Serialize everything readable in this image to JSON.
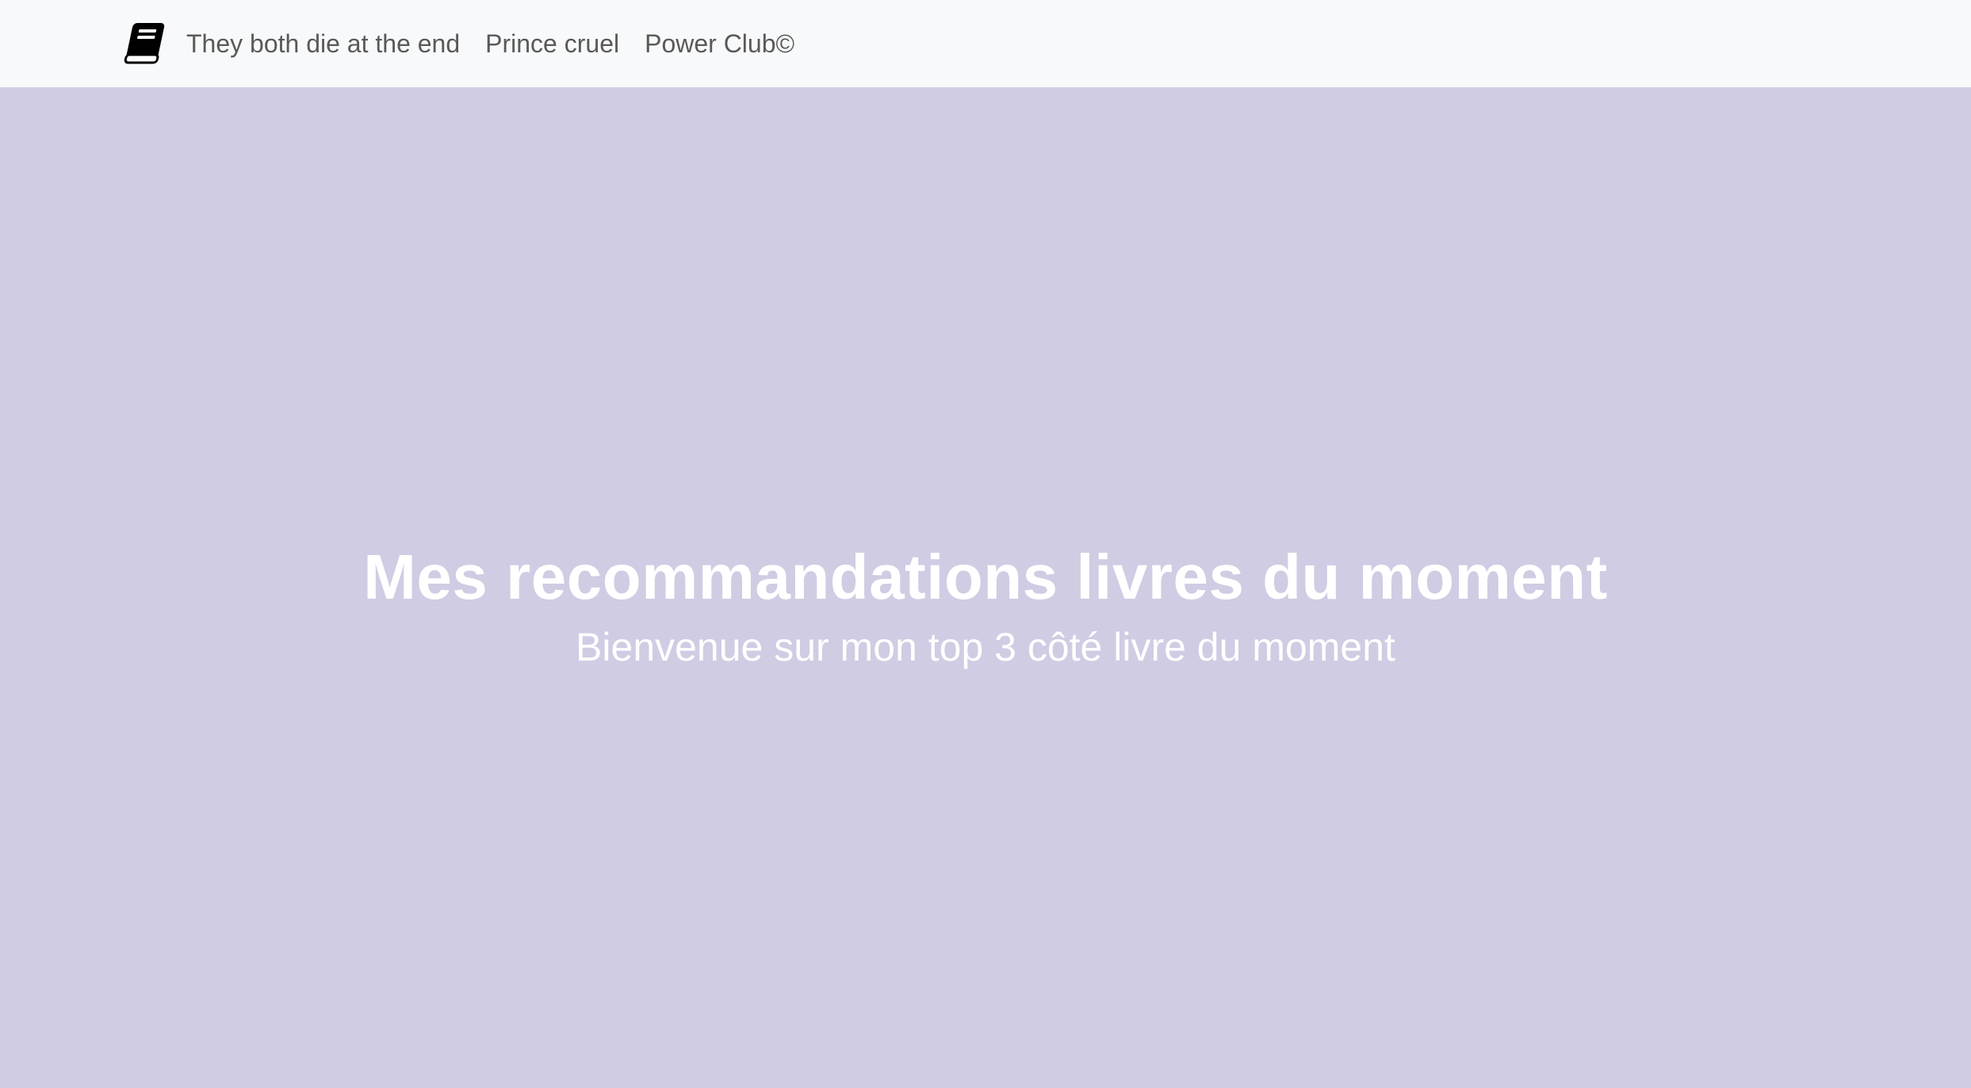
{
  "navbar": {
    "brand_icon": "book-icon",
    "links": [
      {
        "label": "They both die at the end"
      },
      {
        "label": "Prince cruel"
      },
      {
        "label": "Power Club©"
      }
    ]
  },
  "hero": {
    "title": "Mes recommandations livres du moment",
    "subtitle": "Bienvenue sur mon top 3 côté livre du moment"
  },
  "colors": {
    "navbar_bg": "#f8f9fa",
    "hero_bg": "#d0cce3",
    "hero_text": "#ffffff",
    "nav_text": "#595959"
  }
}
